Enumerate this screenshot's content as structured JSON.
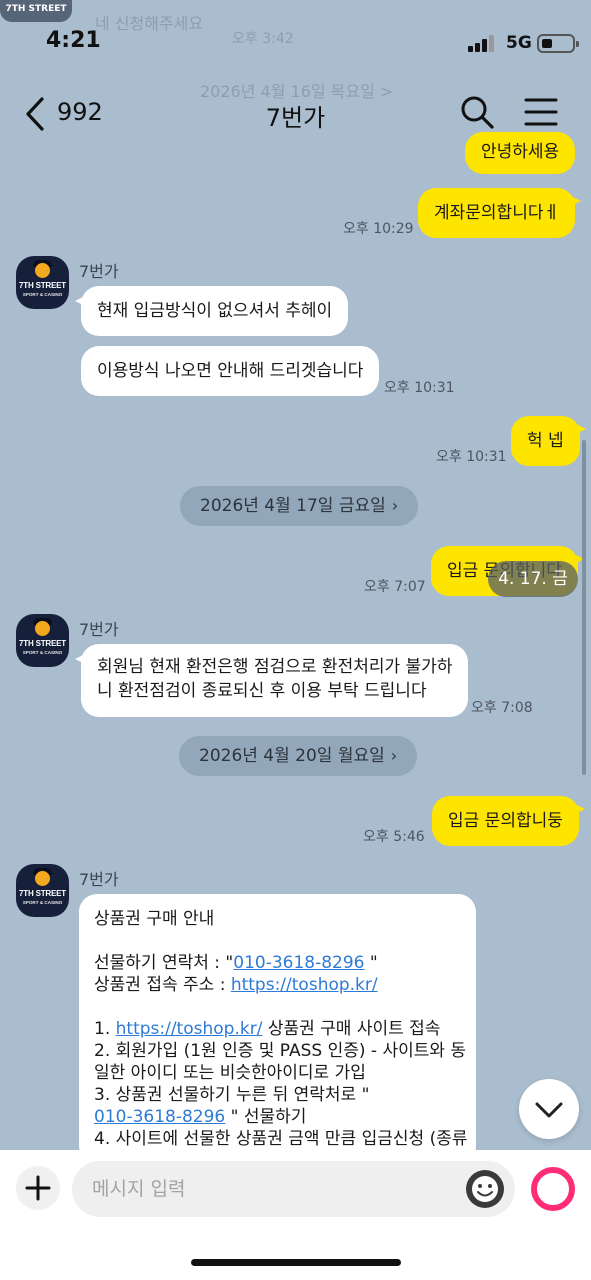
{
  "status_bar": {
    "time": "4:21",
    "network": "5G"
  },
  "ghost": {
    "logo": "7TH STREET",
    "bubble": "네 신청해주세요",
    "time": "오후 3:42",
    "date": "2026년 4월 16일 목요일 >"
  },
  "header": {
    "back_count": "992",
    "title": "7번가"
  },
  "messages": {
    "m1": {
      "text": "안녕하세용"
    },
    "m2": {
      "text": "계좌문의합니다ㅔ",
      "time": "오후 10:29"
    },
    "g1": {
      "sender": "7번가",
      "text1": "현재 입금방식이 없으셔서 추헤이",
      "text2": "이용방식 나오면 안내해 드리겟습니다",
      "time": "오후 10:31"
    },
    "m3": {
      "text": "헉 넵",
      "time": "오후 10:31"
    },
    "d1": "2026년 4월 17일 금요일",
    "m4": {
      "text": "입금 문의합니댜",
      "time": "오후 7:07"
    },
    "g2": {
      "sender": "7번가",
      "line1": "회원님 현재 환전은행 점검으로 환전처리가 불가하",
      "line2": "니 환전점검이 종료되신 후 이용 부탁 드립니다",
      "time": "오후 7:08"
    },
    "d2": "2026년 4월 20일 월요일",
    "m5": {
      "text": "입금 문의합니둥",
      "time": "오후 5:46"
    },
    "g3": {
      "sender": "7번가",
      "title": "상품권 구매 안내",
      "gift_label": "선물하기 연락처 : \"",
      "phone": "010-3618-8296",
      "quote_end": " \"",
      "site_label": "상품권 접속 주소 : ",
      "site": "https://toshop.kr/",
      "s1_prefix": "1. ",
      "s1_suffix": " 상품권 구매 사이트 접속",
      "s2a": "2. 회원가입 (1원 인증 및 PASS 인증) - 사이트와 동",
      "s2b": "일한 아이디 또는 비슷한아이디로 가입",
      "s3a": "3. 상품권 선물하기 누른 뒤 연락처로 \"",
      "s3_suffix": " \" 선물하기",
      "s4": "4. 사이트에 선물한 상품권 금액 만큼 입금신청 (종류"
    }
  },
  "overlay_date": "4. 17. 금",
  "input": {
    "placeholder": "메시지 입력"
  },
  "avatar": {
    "line1": "7TH STREET",
    "line2": "SPORT & CASINO"
  },
  "colors": {
    "background": "#a9bdcf",
    "my_bubble": "#fee500",
    "their_bubble": "#ffffff",
    "link": "#2e7bd6",
    "send_ring": "#ff2d78"
  },
  "icons": [
    "back-chevron-icon",
    "search-icon",
    "menu-icon",
    "chevron-down-icon",
    "plus-icon",
    "emoji-icon",
    "send-icon"
  ]
}
